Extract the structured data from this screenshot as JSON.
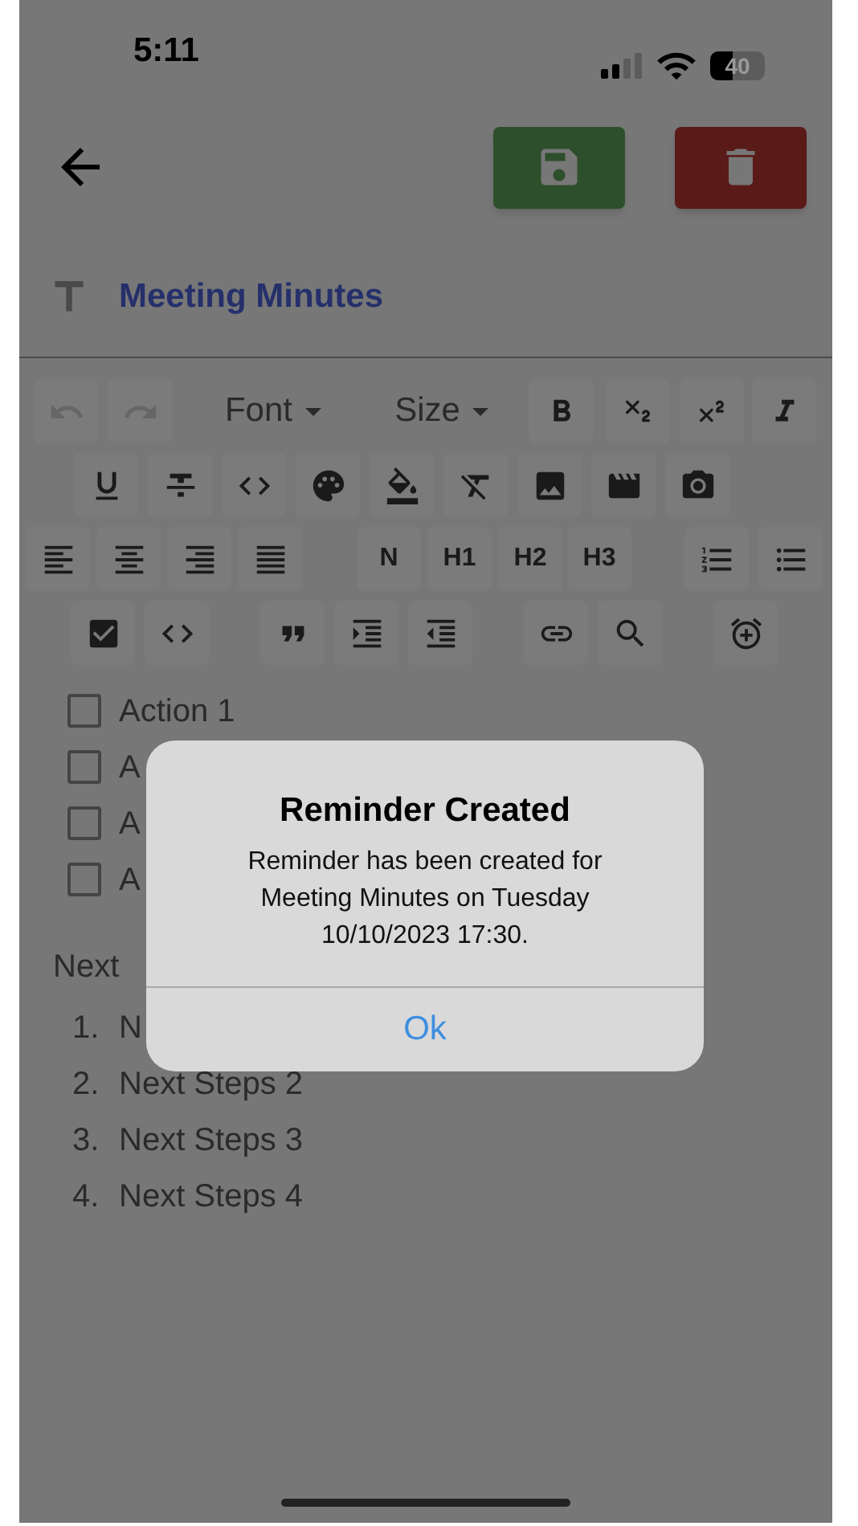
{
  "status_bar": {
    "time": "5:11",
    "battery": "40"
  },
  "header": {
    "title": "Meeting Minutes"
  },
  "toolbar": {
    "rows": [
      [
        {
          "kind": "icon",
          "disabled": true
        },
        {
          "kind": "icon",
          "disabled": true
        },
        {
          "kind": "dropdown",
          "label": "Font",
          "disabled": false
        },
        {
          "kind": "dropdown",
          "label": "Size",
          "disabled": false
        },
        {
          "kind": "icon",
          "disabled": false
        },
        {
          "kind": "icon",
          "disabled": false
        },
        {
          "kind": "icon",
          "disabled": false
        },
        {
          "kind": "icon",
          "disabled": false
        }
      ],
      [
        {
          "kind": "icon",
          "disabled": false
        },
        {
          "kind": "icon",
          "disabled": false
        },
        {
          "kind": "icon",
          "disabled": false
        },
        {
          "kind": "icon",
          "disabled": false
        },
        {
          "kind": "icon",
          "disabled": false
        },
        {
          "kind": "icon",
          "disabled": false
        },
        {
          "kind": "icon",
          "disabled": false
        },
        {
          "kind": "icon",
          "disabled": false
        },
        {
          "kind": "icon",
          "disabled": false
        }
      ],
      [
        {
          "kind": "icon",
          "disabled": false
        },
        {
          "kind": "icon",
          "disabled": false
        },
        {
          "kind": "icon",
          "disabled": false
        },
        {
          "kind": "icon",
          "disabled": false
        },
        {
          "kind": "text",
          "label": "N",
          "disabled": false
        },
        {
          "kind": "text",
          "label": "H1",
          "disabled": false
        },
        {
          "kind": "text",
          "label": "H2",
          "disabled": false
        },
        {
          "kind": "text",
          "label": "H3",
          "disabled": false
        },
        {
          "kind": "icon",
          "disabled": false
        },
        {
          "kind": "icon",
          "disabled": false
        }
      ],
      [
        {
          "kind": "icon",
          "disabled": false
        },
        {
          "kind": "icon",
          "disabled": false
        },
        {
          "kind": "icon",
          "disabled": false
        },
        {
          "kind": "icon",
          "disabled": false
        },
        {
          "kind": "icon",
          "disabled": false
        },
        {
          "kind": "icon",
          "disabled": false
        },
        {
          "kind": "icon",
          "disabled": false
        },
        {
          "kind": "icon",
          "disabled": false
        }
      ]
    ]
  },
  "checklist": [
    {
      "label": "Action 1",
      "checked": false
    },
    {
      "label": "A",
      "checked": false
    },
    {
      "label": "A",
      "checked": false
    },
    {
      "label": "A",
      "checked": false
    }
  ],
  "section_heading": "Next",
  "numbered_list": [
    {
      "number": "1.",
      "label": "N"
    },
    {
      "number": "2.",
      "label": "Next Steps 2"
    },
    {
      "number": "3.",
      "label": "Next Steps 3"
    },
    {
      "number": "4.",
      "label": "Next Steps 4"
    }
  ],
  "dialog": {
    "title": "Reminder Created",
    "message": "Reminder has been created for Meeting Minutes on Tuesday 10/10/2023 17:30.",
    "button": "Ok"
  }
}
